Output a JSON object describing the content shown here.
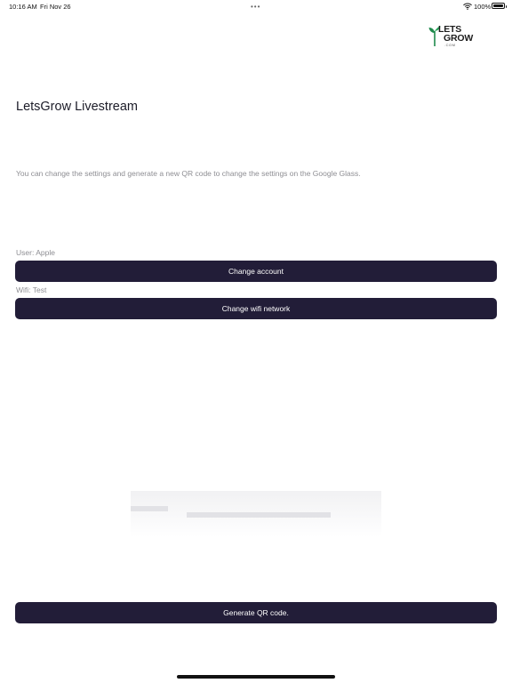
{
  "status_bar": {
    "time": "10:16 AM",
    "date": "Fri Nov 26",
    "dots": "•••",
    "battery": "100%",
    "battery_level": 1.0
  },
  "logo": {
    "line1": "LETS",
    "line2": "GROW",
    "sub": ".COM"
  },
  "title": "LetsGrow Livestream",
  "description": "You can change the settings and generate a new QR code to change the settings on the Google Glass.",
  "user": {
    "label": "User: Apple",
    "button": "Change account"
  },
  "wifi": {
    "label": "Wifi: Test",
    "button": "Change wifi network"
  },
  "generate_button": "Generate QR code.",
  "colors": {
    "button_bg": "#221d38",
    "button_text": "#ffffff",
    "muted_text": "#8e8e93",
    "logo_green": "#1f8a4c"
  }
}
